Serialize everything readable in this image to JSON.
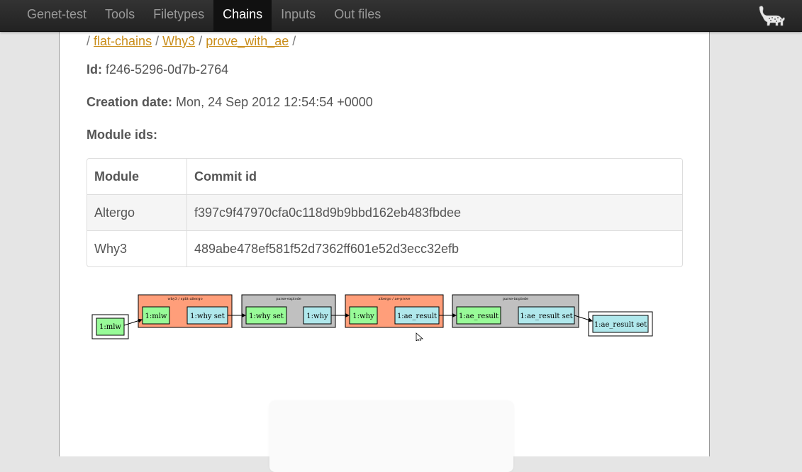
{
  "nav": {
    "items": [
      {
        "label": "Genet-test",
        "active": false
      },
      {
        "label": "Tools",
        "active": false
      },
      {
        "label": "Filetypes",
        "active": false
      },
      {
        "label": "Chains",
        "active": true
      },
      {
        "label": "Inputs",
        "active": false
      },
      {
        "label": "Out files",
        "active": false
      }
    ],
    "logo_icon": "leopard-logo-icon"
  },
  "breadcrumb": {
    "items": [
      "flat-chains",
      "Why3",
      "prove_with_ae"
    ],
    "separator": "/"
  },
  "details": {
    "id_label": "Id:",
    "id_value": "f246-5296-0d7b-2764",
    "date_label": "Creation date:",
    "date_value": "Mon, 24 Sep 2012 12:54:54 +0000",
    "modules_label": "Module ids:"
  },
  "module_table": {
    "headers": [
      "Module",
      "Commit id"
    ],
    "rows": [
      {
        "module": "Altergo",
        "commit": "f397c9f47970cfa0c118d9b9bbd162eb483fbdee"
      },
      {
        "module": "Why3",
        "commit": "489abe478ef581f52d7362ff601e52d3ecc32efb"
      }
    ]
  },
  "graph": {
    "colors": {
      "orange": "#ff9e7a",
      "gray": "#c0c0c0",
      "green": "#98fb98",
      "cyan": "#b0e8ec"
    },
    "input_node": "1:mlw",
    "output_node": "1:ae_result set",
    "clusters": [
      {
        "title": "why3 / split-altergo",
        "color": "orange",
        "in": "1:mlw",
        "out": "1:why set"
      },
      {
        "title": "parse-explode",
        "color": "gray",
        "in": "1:why set",
        "out": "1:why"
      },
      {
        "title": "altergo / ae-prove",
        "color": "orange",
        "in": "1:why",
        "out": "1:ae_result"
      },
      {
        "title": "parse-implode",
        "color": "gray",
        "in": "1:ae_result",
        "out": "1:ae_result set"
      }
    ]
  }
}
